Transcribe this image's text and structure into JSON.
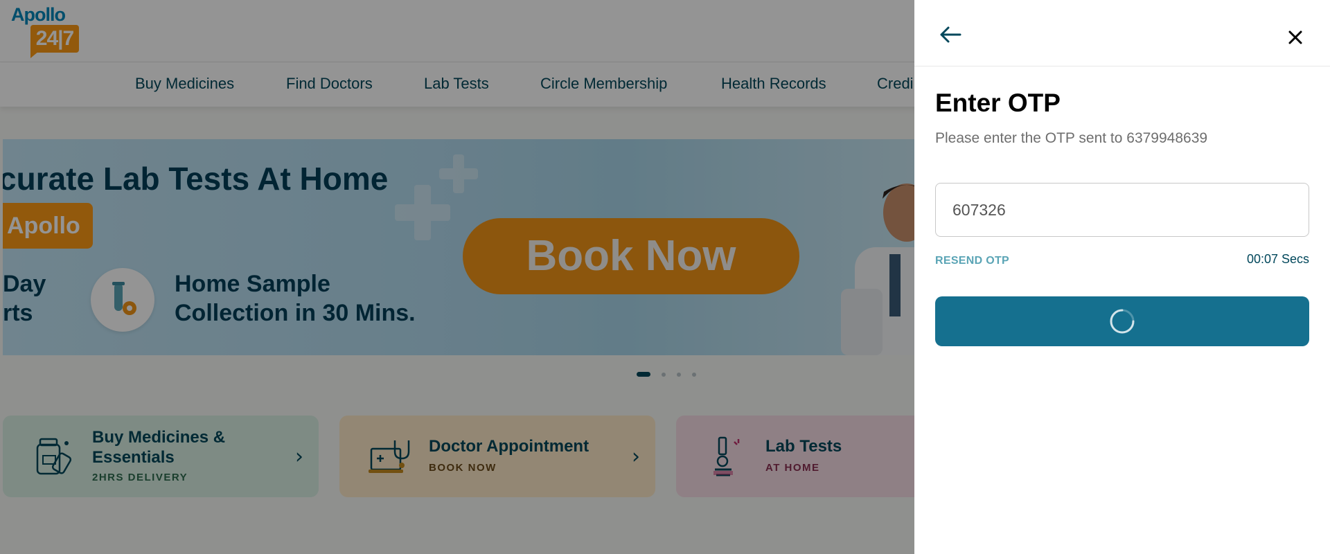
{
  "logo": {
    "word": "Apollo",
    "box": "24|7"
  },
  "nav": {
    "items": [
      {
        "label": "Buy Medicines"
      },
      {
        "label": "Find Doctors"
      },
      {
        "label": "Lab Tests"
      },
      {
        "label": "Circle Membership"
      },
      {
        "label": "Health Records"
      },
      {
        "label": "Credi"
      }
    ]
  },
  "banner": {
    "title": "curate Lab Tests At Home",
    "badge": "Apollo",
    "left_line1": "Day",
    "left_line2": "rts",
    "sample_line1": "Home Sample",
    "sample_line2": "Collection in 30 Mins.",
    "cta": "Book Now",
    "prev_icon": "chevron-left-icon"
  },
  "carousel": {
    "slide_count": 4,
    "active_index": 0
  },
  "cards": [
    {
      "title_line1": "Buy Medicines &",
      "title_line2": "Essentials",
      "subtitle": "2HRS DELIVERY",
      "bg": "#d9f0e4",
      "sub_color": "#2d6b4f",
      "icon": "medicine-bottle-icon"
    },
    {
      "title_line1": "Doctor Appointment",
      "title_line2": "",
      "subtitle": "BOOK NOW",
      "bg": "#fde9c8",
      "sub_color": "#6b4a1a",
      "icon": "laptop-stethoscope-icon"
    },
    {
      "title_line1": "Lab Tests",
      "title_line2": "",
      "subtitle": "AT HOME",
      "bg": "#f7dde6",
      "sub_color": "#8a2f52",
      "icon": "microscope-icon"
    }
  ],
  "otp_panel": {
    "back_icon": "arrow-left-icon",
    "close_icon": "close-icon",
    "title": "Enter OTP",
    "subtitle": "Please enter the OTP sent to 6379948639",
    "otp_value": "607326",
    "resend_label": "RESEND OTP",
    "timer": "00:07 Secs",
    "submit_state": "loading",
    "accent": "#15708f"
  }
}
